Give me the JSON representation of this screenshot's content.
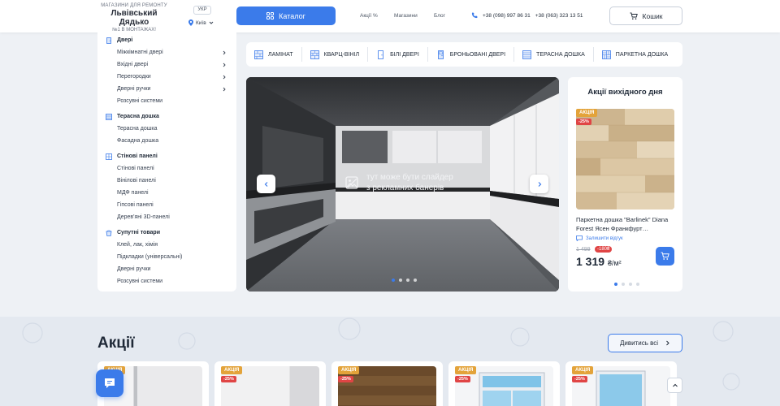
{
  "header": {
    "logo_top": "МАГАЗИНИ ДЛЯ РЕМОНТУ",
    "logo_name": "Львівський Дядько",
    "logo_sub": "№1 В МОНТАЖАХ!",
    "lang": "УКР",
    "city": "Київ",
    "catalog_label": "Каталог",
    "nav": [
      "Акції %",
      "Магазини",
      "Блог"
    ],
    "phone1": "+38 (098) 997 86 31",
    "phone2": "+38 (063) 323 13 51",
    "cart_label": "Кошик"
  },
  "sidebar": {
    "groups": [
      {
        "title": "Двері",
        "icon": "door-icon",
        "items": [
          {
            "label": "Міжкімнатні двері",
            "sub": true
          },
          {
            "label": "Вхідні двері",
            "sub": true
          },
          {
            "label": "Перегородки",
            "sub": true
          },
          {
            "label": "Дверні ручки",
            "sub": true
          },
          {
            "label": "Розсувні системи",
            "sub": false
          }
        ]
      },
      {
        "title": "Терасна дошка",
        "icon": "board-icon",
        "items": [
          {
            "label": "Терасна дошка",
            "sub": false
          },
          {
            "label": "Фасадна дошка",
            "sub": false
          }
        ]
      },
      {
        "title": "Стінові панелі",
        "icon": "panel-icon",
        "items": [
          {
            "label": "Стінові панелі",
            "sub": false
          },
          {
            "label": "Вінілові панелі",
            "sub": false
          },
          {
            "label": "МДФ панелі",
            "sub": false
          },
          {
            "label": "Гіпсові панелі",
            "sub": false
          },
          {
            "label": "Дерев'яні 3D-панелі",
            "sub": false
          }
        ]
      },
      {
        "title": "Супутні товари",
        "icon": "bucket-icon",
        "items": [
          {
            "label": "Клей, лак, хімія",
            "sub": false
          },
          {
            "label": "Підкладки (універсальні)",
            "sub": false
          },
          {
            "label": "Дверні ручки",
            "sub": false
          },
          {
            "label": "Розсувні системи",
            "sub": false
          }
        ]
      }
    ]
  },
  "quick": [
    {
      "label": "ЛАМІНАТ",
      "icon": "laminate-icon"
    },
    {
      "label": "КВАРЦ-ВІНІЛ",
      "icon": "quartz-vinyl-icon"
    },
    {
      "label": "БІЛІ ДВЕРІ",
      "icon": "white-door-icon"
    },
    {
      "label": "БРОНЬОВАНІ ДВЕРІ",
      "icon": "armored-door-icon"
    },
    {
      "label": "ТЕРАСНА ДОШКА",
      "icon": "terrace-board-icon"
    },
    {
      "label": "ПАРКЕТНА ДОШКА",
      "icon": "parquet-icon"
    }
  ],
  "banner": {
    "text": "тут може бути слайдер\nз рекламних банерів",
    "slides": 4,
    "active": 0
  },
  "deal": {
    "title": "Акції вихідного дня",
    "badge": "АКЦІЯ",
    "percent": "-25%",
    "name": "Паркетна дошка \"Barlinek\" Diana Forest Ясен Франкфурт…",
    "review": "Залишити відгук",
    "old_price": "1 499",
    "discount": "-180₴",
    "price": "1 319",
    "unit": "₴/м²",
    "slides": 4,
    "active": 0
  },
  "promo": {
    "title": "Акції",
    "see_all": "Дивитись всі",
    "cards": [
      {
        "badge": "АКЦІЯ",
        "percent": ""
      },
      {
        "badge": "АКЦІЯ",
        "percent": "-25%"
      },
      {
        "badge": "АКЦІЯ",
        "percent": "-25%"
      },
      {
        "badge": "АКЦІЯ",
        "percent": "-25%"
      },
      {
        "badge": "АКЦІЯ",
        "percent": "-25%"
      }
    ]
  },
  "colors": {
    "accent": "#3b7bea",
    "sale_badge": "#e3a33a",
    "discount_badge": "#e04545"
  }
}
